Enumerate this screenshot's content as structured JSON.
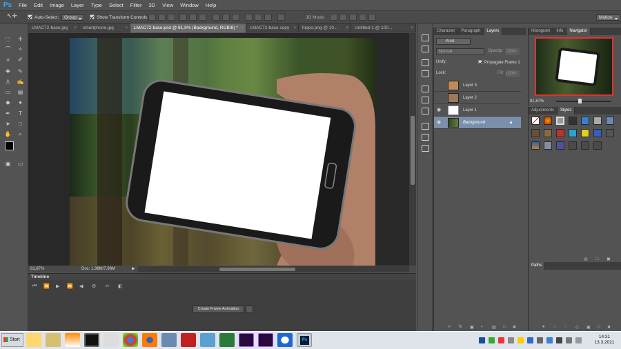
{
  "app": {
    "logo": "Ps"
  },
  "menubar": {
    "items": [
      "File",
      "Edit",
      "Image",
      "Layer",
      "Type",
      "Select",
      "Filter",
      "3D",
      "View",
      "Window",
      "Help"
    ]
  },
  "options": {
    "auto_select_label": "Auto-Select:",
    "auto_select_value": "Group",
    "show_transform_label": "Show Transform Controls",
    "mode_3d_label": "3D Mode:",
    "workspace": "Motion"
  },
  "doc_tabs": [
    {
      "label": "LMAC72-base.jpg",
      "active": false
    },
    {
      "label": "smartphone.jpg",
      "active": false
    },
    {
      "label": "LMAC72-base.psd @ 81,9% (Background, RGB/8) *",
      "active": true
    },
    {
      "label": "LMAC72-base copy",
      "active": false
    },
    {
      "label": "hippo.png @ 10...",
      "active": false
    },
    {
      "label": "Untitled-1 @ 100...",
      "active": false
    }
  ],
  "status": {
    "zoom": "81,87%",
    "doc": "Doc: 1,98M/7,96M"
  },
  "timeline": {
    "title": "Timeline",
    "create_button": "Create Frame Animation"
  },
  "layers_panel": {
    "tabs": [
      "Character",
      "Paragraph",
      "Layers"
    ],
    "active_tab": "Layers",
    "filter_kind": "Kind",
    "blend_mode": "Normal",
    "opacity_label": "Opacity:",
    "opacity_value": "100%",
    "unify_label": "Unify:",
    "propagate_label": "Propagate Frame 1",
    "lock_label": "Lock:",
    "fill_label": "Fill:",
    "fill_value": "100%",
    "layers": [
      {
        "name": "Layer 3",
        "visible": false,
        "selected": false
      },
      {
        "name": "Layer 2",
        "visible": false,
        "selected": false
      },
      {
        "name": "Layer 1",
        "visible": true,
        "selected": false
      },
      {
        "name": "Background",
        "visible": true,
        "selected": true
      }
    ]
  },
  "navigator_panel": {
    "tabs": [
      "Histogram",
      "Info",
      "Navigator"
    ],
    "active_tab": "Navigator",
    "zoom": "81,87%"
  },
  "styles_panel": {
    "tabs": [
      "Adjustments",
      "Styles"
    ],
    "active_tab": "Styles"
  },
  "paths_panel": {
    "title": "Paths"
  },
  "taskbar": {
    "start_label": "Start",
    "time": "14:31",
    "date": "13.3.2021"
  },
  "colors": {
    "ps_blue": "#31a8ff",
    "selected_layer": "#7b8fab",
    "navigator_frame": "#d33333"
  }
}
